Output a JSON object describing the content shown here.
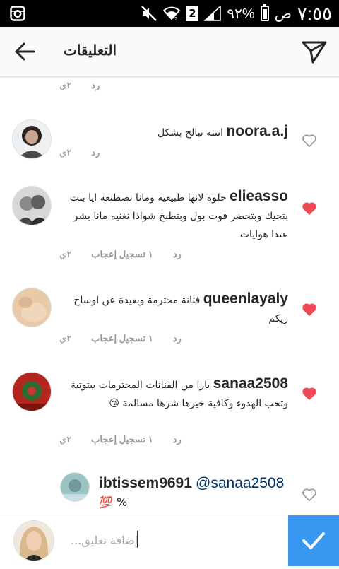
{
  "status_bar": {
    "time": "٧:٥٥",
    "ampm": "ص",
    "battery_pct": "٩٢%",
    "sim_number": "2"
  },
  "header": {
    "title": "التعليقات"
  },
  "top_partial": {
    "reply": "رد",
    "time": "٢ي"
  },
  "comments": [
    {
      "username": "noora.a.j",
      "text": "انتته تبالج بشكل",
      "reply": "رد",
      "likes": "",
      "time": "٢ي",
      "liked": false
    },
    {
      "username": "elieasso",
      "text": "حلوة لانها طبيعية ومانا نصطنعة ايا بنت بتحيك وبتحضر فوت بول وبتطبخ  شواذا نغنيه مانا بشر عتدا هوايات",
      "reply": "رد",
      "likes": "١ تسجيل إعجاب",
      "time": "٢ي",
      "liked": true
    },
    {
      "username": "queenlayaly",
      "text": "فنانة محترمة وبعيدة عن اوساخ زيكم",
      "reply": "رد",
      "likes": "١ تسجيل إعجاب",
      "time": "٢ي",
      "liked": true
    },
    {
      "username": "sanaa2508",
      "text": "يارا من الفنانات المحترمات بيتوتية وتحب الهدوء وكافية خيرها شرها مسالمة",
      "emoji": "😘",
      "reply": "رد",
      "likes": "١ تسجيل إعجاب",
      "time": "٢ي",
      "liked": true
    }
  ],
  "reply_comment": {
    "username": "ibtissem9691",
    "mention": "@sanaa2508",
    "text": "%",
    "emoji": "💯",
    "liked": false
  },
  "composer": {
    "placeholder": "إضافة تعليق..."
  },
  "colors": {
    "like_red": "#ed4956",
    "submit_blue": "#3897f0",
    "mention_blue": "#003569",
    "meta_gray": "#999999"
  },
  "icons": {
    "back": "arrow-left-icon",
    "send": "paper-plane-icon",
    "heart_filled": "heart-filled-icon",
    "heart_outline": "heart-outline-icon",
    "submit": "checkmark-icon"
  }
}
